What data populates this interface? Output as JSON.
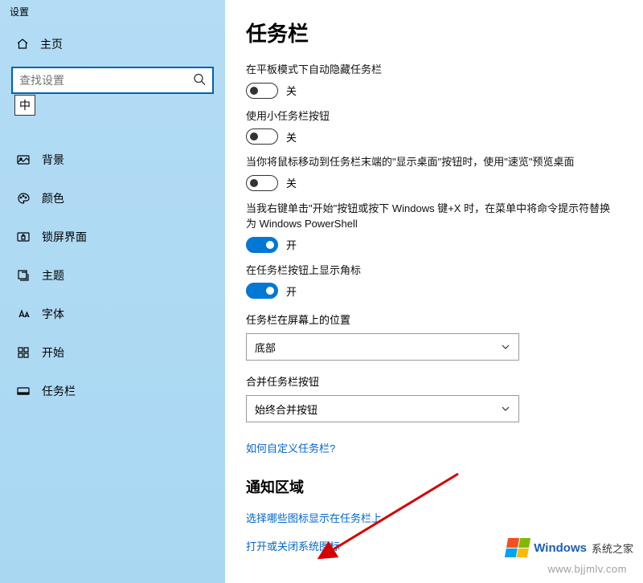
{
  "sidebar": {
    "app_title": "设置",
    "home_label": "主页",
    "search_placeholder": "查找设置",
    "ime_badge": "中",
    "items": [
      {
        "label": "背景"
      },
      {
        "label": "颜色"
      },
      {
        "label": "锁屏界面"
      },
      {
        "label": "主题"
      },
      {
        "label": "字体"
      },
      {
        "label": "开始"
      },
      {
        "label": "任务栏"
      }
    ]
  },
  "main": {
    "title": "任务栏",
    "toggle_state_on": "开",
    "toggle_state_off": "关",
    "settings": [
      {
        "label": "在平板模式下自动隐藏任务栏",
        "on": false
      },
      {
        "label": "使用小任务栏按钮",
        "on": false
      },
      {
        "label": "当你将鼠标移动到任务栏末端的\"显示桌面\"按钮时，使用\"速览\"预览桌面",
        "on": false
      },
      {
        "label": "当我右键单击\"开始\"按钮或按下 Windows 键+X 时，在菜单中将命令提示符替换为 Windows PowerShell",
        "on": true
      },
      {
        "label": "在任务栏按钮上显示角标",
        "on": true
      }
    ],
    "position": {
      "label": "任务栏在屏幕上的位置",
      "value": "底部"
    },
    "combine": {
      "label": "合并任务栏按钮",
      "value": "始终合并按钮"
    },
    "help_link": "如何自定义任务栏?",
    "notification_heading": "通知区域",
    "notif_link1": "选择哪些图标显示在任务栏上",
    "notif_link2": "打开或关闭系统图标"
  },
  "watermark": {
    "brand": "Windows",
    "brand_suffix": "系统之家",
    "url": "www.bjjmlv.com"
  }
}
